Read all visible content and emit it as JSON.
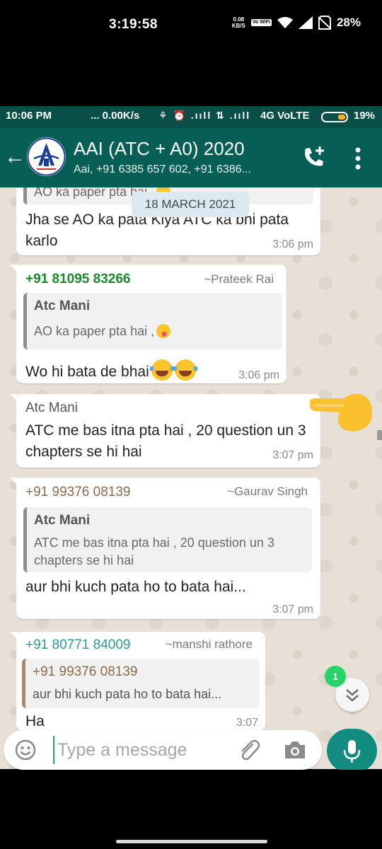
{
  "outer_status": {
    "time": "3:19:58",
    "speed_value": "0.08",
    "speed_unit": "KB/S",
    "vowifi": "Vo WiFi",
    "battery": "28%"
  },
  "inner_status": {
    "time": "10:06 PM",
    "speed": "... 0.00K/s",
    "icons": "⚘ ⏰ .ııll ⇅ .ııll",
    "network": "4G VoLTE",
    "battery": "19%",
    "battery_level": 0.19
  },
  "header": {
    "title": "AAI (ATC + A0) 2020",
    "subtitle": "Aai, +91 6385 657 602, +91 6386..."
  },
  "chat": {
    "date_chip": "18 MARCH 2021",
    "messages": [
      {
        "quote_text": "AO ka paper pta hai ,",
        "text": "Jha se AO ka pata Kiya ATC ka bhi pata karlo",
        "time": "3:06 pm"
      },
      {
        "sender_number": "+91 81095 83266",
        "sender_name": "~Prateek Rai",
        "quote_author": "Atc Mani",
        "quote_text": "AO ka paper pta hai ,",
        "text": "Wo hi bata de bhai",
        "time": "3:06 pm"
      },
      {
        "sender": "Atc Mani",
        "text": "ATC me bas itna pta hai , 20 question un 3 chapters se hi hai",
        "time": "3:07 pm"
      },
      {
        "sender_number": "+91 99376 08139",
        "sender_name": "~Gaurav Singh",
        "quote_author": "Atc Mani",
        "quote_text": "ATC me bas itna pta hai , 20 question un 3 chapters se hi hai",
        "text": "aur bhi kuch pata ho to bata hai...",
        "time": "3:07 pm"
      },
      {
        "sender_number": "+91 80771 84009",
        "sender_name": "~manshi rathore",
        "quote_author": "+91 99376 08139",
        "quote_text": "aur bhi kuch pata ho to bata hai...",
        "text": "Ha",
        "time": "3:07"
      }
    ],
    "unread_count": "1"
  },
  "composer": {
    "placeholder": "Type a message"
  },
  "colors": {
    "header_bg": "#075e54",
    "status_bg": "#0a4f47",
    "sender_green": "#1a8a2c",
    "sender_brown": "#8a6a4a",
    "sender_teal": "#2a9d8f",
    "mic_bg": "#128c7e",
    "badge_green": "#25d366"
  }
}
